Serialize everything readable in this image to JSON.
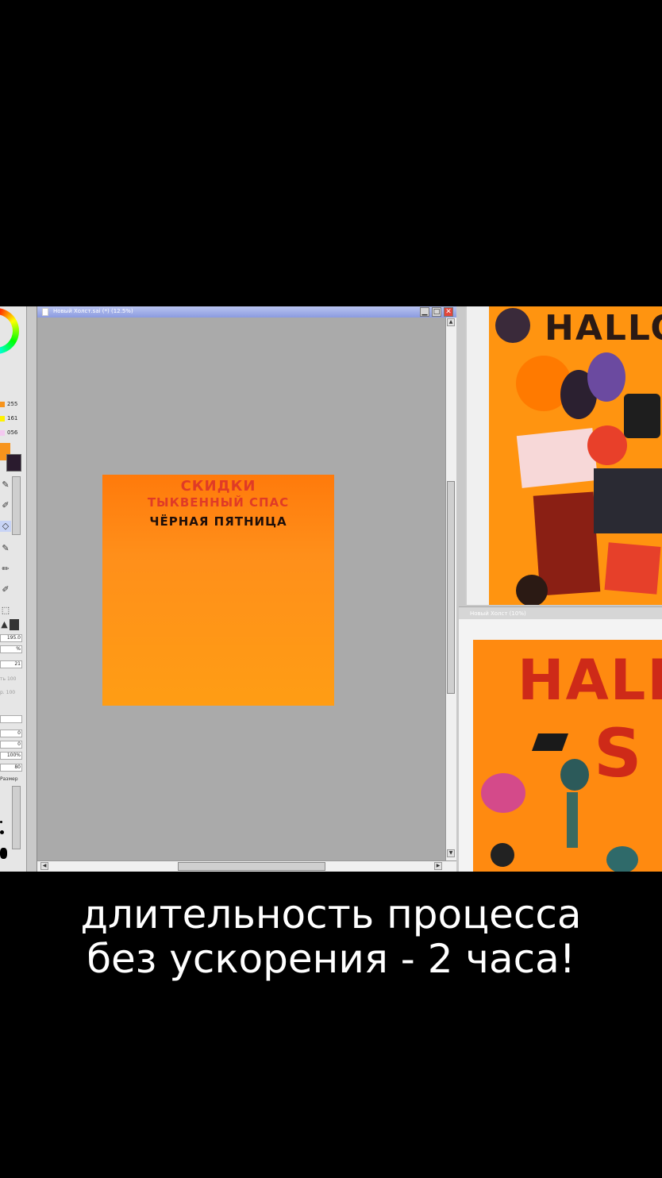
{
  "color_panel": {
    "rgb": [
      {
        "value": "255",
        "swatch": "#f7941d"
      },
      {
        "value": "161",
        "swatch": "#fff200"
      },
      {
        "value": "056",
        "swatch": "#f3c9f0"
      }
    ],
    "foreground": "#f7941d",
    "background": "#2a1b2e"
  },
  "tool_panel": {
    "brush_size": "195.0",
    "percent": "%",
    "value_21": "21",
    "density_label": "ть 100",
    "opacity_label": "р. 100",
    "value_0a": "0",
    "value_0b": "0",
    "value_100pct": "100%",
    "value_80": "80",
    "size_label": "Размер"
  },
  "canvas_window": {
    "title": "Новый Холст.sai (*) (12.5%)",
    "minimize": "▁",
    "maximize": "□",
    "close": "✕"
  },
  "artwork_text": {
    "line1": "СКИДКИ",
    "line2": "ТЫКВЕННЫЙ СПАС",
    "line3": "ЧЁРНАЯ ПЯТНИЦА"
  },
  "reference_1": {
    "headline": "HALLO"
  },
  "reference_2": {
    "title": "Новый Холст (10%)",
    "headline": "HALL",
    "sub": "S"
  },
  "caption": {
    "line1": "длительность процесса",
    "line2": "без ускорения - 2 часа!"
  }
}
